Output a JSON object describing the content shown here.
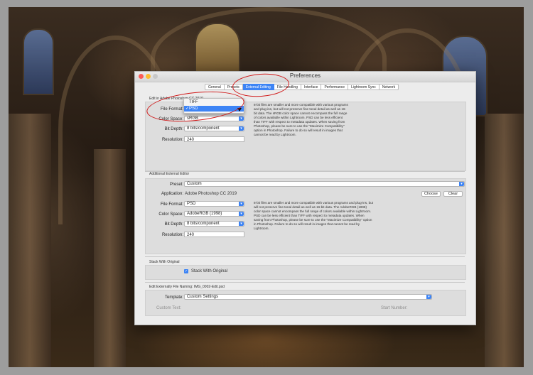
{
  "window": {
    "title": "Preferences"
  },
  "tabs": [
    "General",
    "Presets",
    "External Editing",
    "File Handling",
    "Interface",
    "Performance",
    "Lightroom Sync",
    "Network"
  ],
  "active_tab": "External Editing",
  "edit_in_photoshop": {
    "section_label": "Edit in Adobe Photoshop CC 2019",
    "file_format_label": "File Format:",
    "color_space_label": "Color Space:",
    "color_space_value": "sRGB",
    "bit_depth_label": "Bit Depth:",
    "bit_depth_value": "8 bits/component",
    "resolution_label": "Resolution:",
    "resolution_value": "240",
    "description": "8-bit files are smaller and more compatible with various programs and plug-ins, but will not preserve fine tonal detail as well as 16-bit data. The sRGB color space cannot encompass the full range of colors available within Lightroom. PSD can be less efficient than TIFF with respect to metadata updates. When saving from Photoshop, please be sure to use the \"Maximize Compatibility\" option in Photoshop. Failure to do so will result in images that cannot be read by Lightroom."
  },
  "file_format_menu": {
    "options": [
      "TIFF",
      "PSD"
    ],
    "selected": "PSD",
    "check": "✓"
  },
  "additional_editor": {
    "section_label": "Additional External Editor",
    "preset_label": "Preset:",
    "preset_value": "Custom",
    "application_label": "Application:",
    "application_value": "Adobe Photoshop CC 2019",
    "choose_button": "Choose",
    "clear_button": "Clear",
    "file_format_label": "File Format:",
    "file_format_value": "PSD",
    "color_space_label": "Color Space:",
    "color_space_value": "AdobeRGB (1998)",
    "bit_depth_label": "Bit Depth:",
    "bit_depth_value": "8 bits/component",
    "resolution_label": "Resolution:",
    "resolution_value": "240",
    "description": "8-bit files are smaller and more compatible with various programs and plug-ins, but will not preserve fine tonal detail as well as 16-bit data. The AdobeRGB (1998) color space cannot encompass the full range of colors available within Lightroom. PSD can be less efficient than TIFF with respect to metadata updates. When saving from Photoshop, please be sure to use the \"Maximize Compatibility\" option in Photoshop. Failure to do so will result in images that cannot be read by Lightroom."
  },
  "stack": {
    "section_label": "Stack With Original",
    "checkbox_label": "Stack With Original",
    "checked": true
  },
  "naming": {
    "section_label": "Edit Externally File Naming: IMG_0002-Edit.psd",
    "template_label": "Template:",
    "template_value": "Custom Settings",
    "custom_text_label": "Custom Text:",
    "start_number_label": "Start Number:"
  },
  "colors": {
    "accent": "#3d84f5",
    "annotation": "#d01818"
  }
}
